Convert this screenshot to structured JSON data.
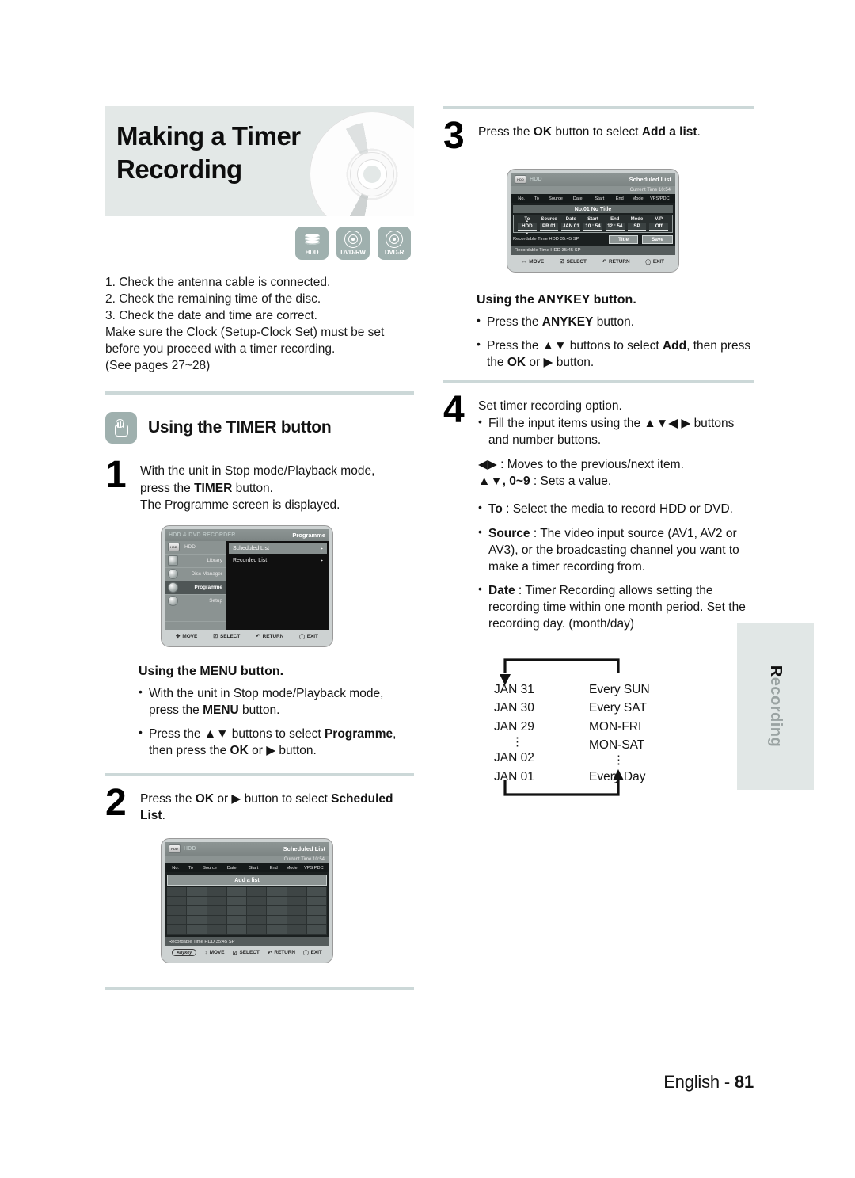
{
  "banner": {
    "title": "Making a Timer Recording"
  },
  "media_badges": [
    {
      "label": "HDD",
      "icon": "hdd-stack-icon"
    },
    {
      "label": "DVD-RW",
      "icon": "disc-icon"
    },
    {
      "label": "DVD-R",
      "icon": "disc-icon"
    }
  ],
  "intro": {
    "line1": "1. Check the antenna cable is connected.",
    "line2": "2. Check the remaining time of the disc.",
    "line3": "3. Check the date and time are correct.",
    "line4": "Make sure the Clock (Setup-Clock Set) must be set",
    "line5": "before you proceed with a timer recording.",
    "line6": "(See pages 27~28)"
  },
  "timer_section": {
    "heading": "Using the TIMER button",
    "icon": "hand-press-icon"
  },
  "step1": {
    "number": "1",
    "line1_a": "With the unit in Stop mode/Playback mode,",
    "line1_b": "press the ",
    "line1_bold": "TIMER",
    "line1_c": " button.",
    "line2": "The Programme screen is displayed."
  },
  "osd_programme": {
    "brand": "HDD & DVD RECORDER",
    "mini_label": "HDD",
    "title_right": "Programme",
    "side_items": [
      {
        "label": "HDD",
        "selected": false
      },
      {
        "label": "Library",
        "selected": false
      },
      {
        "label": "Disc Manager",
        "selected": false
      },
      {
        "label": "Programme",
        "selected": true
      },
      {
        "label": "Setup",
        "selected": false
      }
    ],
    "menu_items": [
      {
        "label": "Scheduled List",
        "selected": true,
        "arrow": "▸"
      },
      {
        "label": "Recorded List",
        "selected": false,
        "arrow": "▸"
      }
    ],
    "nav": [
      {
        "icon": "✥",
        "label": "MOVE"
      },
      {
        "icon": "☑",
        "label": "SELECT"
      },
      {
        "icon": "↶",
        "label": "RETURN"
      },
      {
        "icon": "ⓘ",
        "label": "EXIT"
      }
    ]
  },
  "menu_section": {
    "heading": "Using the MENU button.",
    "b1_a": "With the unit in Stop mode/Playback mode, press the ",
    "b1_bold": "MENU",
    "b1_b": " button.",
    "b2_a": "Press the ▲▼ buttons to select ",
    "b2_bold": "Programme",
    "b2_b": ", then press the ",
    "b2_bold2": "OK",
    "b2_c": " or ▶ button."
  },
  "step2": {
    "number": "2",
    "text_a": "Press the ",
    "bold1": "OK",
    "text_b": " or ▶ button to select ",
    "bold2": "Scheduled List",
    "text_c": "."
  },
  "osd_scheduled": {
    "mini_label": "HDD",
    "device": "HDD",
    "title_right": "Scheduled List",
    "current_time": "Current Time 10:54",
    "columns": [
      "No.",
      "To",
      "Source",
      "Date",
      "Start",
      "End",
      "Mode",
      "VPS PDC"
    ],
    "add_list": "Add a list",
    "recordable": "Recordable Time   HDD   35:45 SP",
    "anykey": "Anykey",
    "nav": [
      {
        "icon": "↕",
        "label": "MOVE"
      },
      {
        "icon": "☑",
        "label": "SELECT"
      },
      {
        "icon": "↶",
        "label": "RETURN"
      },
      {
        "icon": "ⓘ",
        "label": "EXIT"
      }
    ]
  },
  "step3": {
    "number": "3",
    "text_a": "Press the ",
    "bold1": "OK",
    "text_b": " button to select ",
    "bold2": "Add a list",
    "text_c": "."
  },
  "osd_detail": {
    "mini_label": "HDD",
    "device": "HDD",
    "title_right": "Scheduled List",
    "current_time": "Current Time 10:54",
    "columns": [
      "No.",
      "To",
      "Source",
      "Date",
      "Start",
      "End",
      "Mode",
      "VPS/PDC"
    ],
    "entry_title": "No.01 No Title",
    "detail_columns": [
      "To",
      "Source",
      "Date",
      "Start",
      "End",
      "Mode",
      "V/P"
    ],
    "detail_values": [
      "HDD",
      "PR 01",
      "JAN 01",
      "10 : 54",
      "12 : 54",
      "SP",
      "Off"
    ],
    "recordable_inner": "Recordable Time   HDD   35:45 SP",
    "btn_title": "Title",
    "btn_save": "Save",
    "recordable": "Recordable Time   HDD   35:45 SP",
    "nav": [
      {
        "icon": "↔",
        "label": "MOVE"
      },
      {
        "icon": "☑",
        "label": "SELECT"
      },
      {
        "icon": "↶",
        "label": "RETURN"
      },
      {
        "icon": "ⓘ",
        "label": "EXIT"
      }
    ]
  },
  "anykey_section": {
    "heading": "Using the ANYKEY button.",
    "b1_a": "Press the ",
    "b1_bold": "ANYKEY",
    "b1_b": " button.",
    "b2_a": "Press the ▲▼ buttons to select ",
    "b2_bold": "Add",
    "b2_b": ", then press the ",
    "b2_bold2": "OK",
    "b2_c": " or ▶ button."
  },
  "step4": {
    "number": "4",
    "intro": "Set timer recording option.",
    "b1_a": "Fill the input items using the ▲▼◀ ▶ buttons and number buttons.",
    "nav1": "◀▶ : Moves to the previous/next item.",
    "nav2_bold": "▲▼, 0~9",
    "nav2_rest": " : Sets a value.",
    "items": [
      {
        "bold": "To",
        "text": " : Select the media to record HDD or DVD."
      },
      {
        "bold": "Source",
        "text": " : The video input source (AV1, AV2 or AV3), or the broadcasting channel you want to make a timer recording from."
      },
      {
        "bold": "Date",
        "text": " : Timer Recording allows setting the recording time within one month period. Set the recording day. (month/day)"
      }
    ]
  },
  "date_cycle": {
    "left": [
      "JAN 31",
      "JAN 30",
      "JAN 29",
      "⋮",
      "JAN 02",
      "JAN 01"
    ],
    "right": [
      "Every SUN",
      "Every SAT",
      "MON-FRI",
      "MON-SAT",
      "⋮",
      "Every Day"
    ]
  },
  "side_tab": {
    "first": "R",
    "rest": "ecording"
  },
  "footer": {
    "lang": "English - ",
    "page": "81"
  }
}
